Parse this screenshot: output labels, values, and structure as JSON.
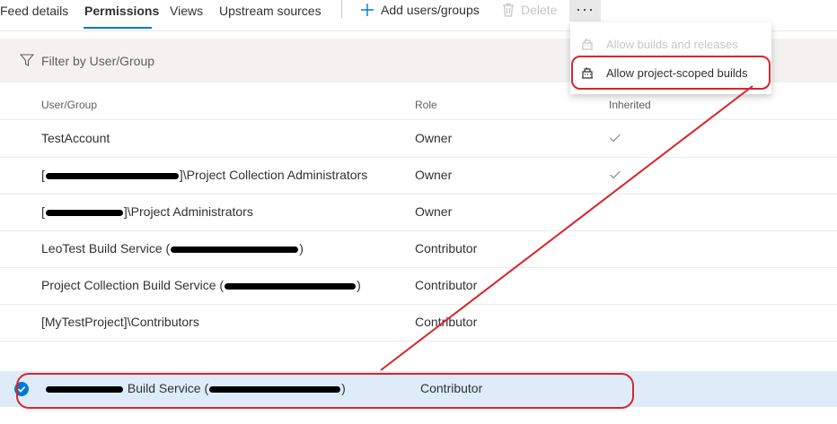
{
  "tabs": [
    {
      "label": "Feed details",
      "active": false
    },
    {
      "label": "Permissions",
      "active": true
    },
    {
      "label": "Views",
      "active": false
    },
    {
      "label": "Upstream sources",
      "active": false
    }
  ],
  "commands": {
    "add_label": "Add users/groups",
    "delete_label": "Delete",
    "more_label": "···"
  },
  "filter": {
    "placeholder": "Filter by User/Group"
  },
  "columns": {
    "user": "User/Group",
    "role": "Role",
    "inherited": "Inherited"
  },
  "rows": [
    {
      "user": "TestAccount",
      "role": "Owner",
      "inherited": true
    },
    {
      "user_prefix": "[",
      "user_suffix": "]\\Project Collection Administrators",
      "role": "Owner",
      "inherited": true
    },
    {
      "user_prefix": "[",
      "user_suffix": "]\\Project Administrators",
      "role": "Owner",
      "inherited": false
    },
    {
      "user_prefix": "LeoTest Build Service (",
      "user_suffix": ")",
      "role": "Contributor",
      "inherited": false
    },
    {
      "user_prefix": "Project Collection Build Service (",
      "user_suffix": ")",
      "role": "Contributor",
      "inherited": false
    },
    {
      "user": "[MyTestProject]\\Contributors",
      "role": "Contributor",
      "inherited": false
    }
  ],
  "selected_row": {
    "user_middle": " Build Service (",
    "user_suffix": ")",
    "role": "Contributor"
  },
  "menu": {
    "items": [
      {
        "label": "Allow builds and releases",
        "disabled": true
      },
      {
        "label": "Allow project-scoped builds",
        "disabled": false
      }
    ]
  },
  "colors": {
    "accent": "#0078d4",
    "annotation": "#d9252b"
  }
}
